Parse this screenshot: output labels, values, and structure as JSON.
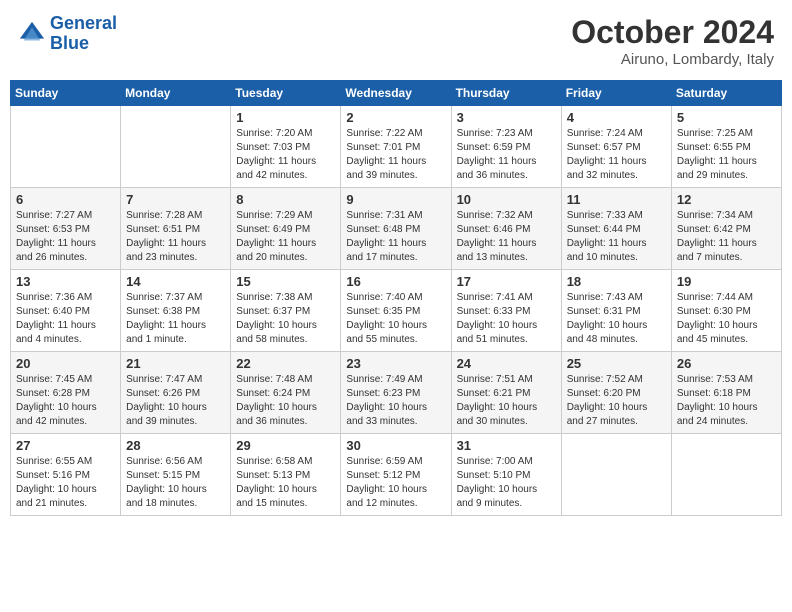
{
  "header": {
    "logo_line1": "General",
    "logo_line2": "Blue",
    "month": "October 2024",
    "location": "Airuno, Lombardy, Italy"
  },
  "weekdays": [
    "Sunday",
    "Monday",
    "Tuesday",
    "Wednesday",
    "Thursday",
    "Friday",
    "Saturday"
  ],
  "weeks": [
    [
      {
        "day": "",
        "info": ""
      },
      {
        "day": "",
        "info": ""
      },
      {
        "day": "1",
        "info": "Sunrise: 7:20 AM\nSunset: 7:03 PM\nDaylight: 11 hours and 42 minutes."
      },
      {
        "day": "2",
        "info": "Sunrise: 7:22 AM\nSunset: 7:01 PM\nDaylight: 11 hours and 39 minutes."
      },
      {
        "day": "3",
        "info": "Sunrise: 7:23 AM\nSunset: 6:59 PM\nDaylight: 11 hours and 36 minutes."
      },
      {
        "day": "4",
        "info": "Sunrise: 7:24 AM\nSunset: 6:57 PM\nDaylight: 11 hours and 32 minutes."
      },
      {
        "day": "5",
        "info": "Sunrise: 7:25 AM\nSunset: 6:55 PM\nDaylight: 11 hours and 29 minutes."
      }
    ],
    [
      {
        "day": "6",
        "info": "Sunrise: 7:27 AM\nSunset: 6:53 PM\nDaylight: 11 hours and 26 minutes."
      },
      {
        "day": "7",
        "info": "Sunrise: 7:28 AM\nSunset: 6:51 PM\nDaylight: 11 hours and 23 minutes."
      },
      {
        "day": "8",
        "info": "Sunrise: 7:29 AM\nSunset: 6:49 PM\nDaylight: 11 hours and 20 minutes."
      },
      {
        "day": "9",
        "info": "Sunrise: 7:31 AM\nSunset: 6:48 PM\nDaylight: 11 hours and 17 minutes."
      },
      {
        "day": "10",
        "info": "Sunrise: 7:32 AM\nSunset: 6:46 PM\nDaylight: 11 hours and 13 minutes."
      },
      {
        "day": "11",
        "info": "Sunrise: 7:33 AM\nSunset: 6:44 PM\nDaylight: 11 hours and 10 minutes."
      },
      {
        "day": "12",
        "info": "Sunrise: 7:34 AM\nSunset: 6:42 PM\nDaylight: 11 hours and 7 minutes."
      }
    ],
    [
      {
        "day": "13",
        "info": "Sunrise: 7:36 AM\nSunset: 6:40 PM\nDaylight: 11 hours and 4 minutes."
      },
      {
        "day": "14",
        "info": "Sunrise: 7:37 AM\nSunset: 6:38 PM\nDaylight: 11 hours and 1 minute."
      },
      {
        "day": "15",
        "info": "Sunrise: 7:38 AM\nSunset: 6:37 PM\nDaylight: 10 hours and 58 minutes."
      },
      {
        "day": "16",
        "info": "Sunrise: 7:40 AM\nSunset: 6:35 PM\nDaylight: 10 hours and 55 minutes."
      },
      {
        "day": "17",
        "info": "Sunrise: 7:41 AM\nSunset: 6:33 PM\nDaylight: 10 hours and 51 minutes."
      },
      {
        "day": "18",
        "info": "Sunrise: 7:43 AM\nSunset: 6:31 PM\nDaylight: 10 hours and 48 minutes."
      },
      {
        "day": "19",
        "info": "Sunrise: 7:44 AM\nSunset: 6:30 PM\nDaylight: 10 hours and 45 minutes."
      }
    ],
    [
      {
        "day": "20",
        "info": "Sunrise: 7:45 AM\nSunset: 6:28 PM\nDaylight: 10 hours and 42 minutes."
      },
      {
        "day": "21",
        "info": "Sunrise: 7:47 AM\nSunset: 6:26 PM\nDaylight: 10 hours and 39 minutes."
      },
      {
        "day": "22",
        "info": "Sunrise: 7:48 AM\nSunset: 6:24 PM\nDaylight: 10 hours and 36 minutes."
      },
      {
        "day": "23",
        "info": "Sunrise: 7:49 AM\nSunset: 6:23 PM\nDaylight: 10 hours and 33 minutes."
      },
      {
        "day": "24",
        "info": "Sunrise: 7:51 AM\nSunset: 6:21 PM\nDaylight: 10 hours and 30 minutes."
      },
      {
        "day": "25",
        "info": "Sunrise: 7:52 AM\nSunset: 6:20 PM\nDaylight: 10 hours and 27 minutes."
      },
      {
        "day": "26",
        "info": "Sunrise: 7:53 AM\nSunset: 6:18 PM\nDaylight: 10 hours and 24 minutes."
      }
    ],
    [
      {
        "day": "27",
        "info": "Sunrise: 6:55 AM\nSunset: 5:16 PM\nDaylight: 10 hours and 21 minutes."
      },
      {
        "day": "28",
        "info": "Sunrise: 6:56 AM\nSunset: 5:15 PM\nDaylight: 10 hours and 18 minutes."
      },
      {
        "day": "29",
        "info": "Sunrise: 6:58 AM\nSunset: 5:13 PM\nDaylight: 10 hours and 15 minutes."
      },
      {
        "day": "30",
        "info": "Sunrise: 6:59 AM\nSunset: 5:12 PM\nDaylight: 10 hours and 12 minutes."
      },
      {
        "day": "31",
        "info": "Sunrise: 7:00 AM\nSunset: 5:10 PM\nDaylight: 10 hours and 9 minutes."
      },
      {
        "day": "",
        "info": ""
      },
      {
        "day": "",
        "info": ""
      }
    ]
  ]
}
